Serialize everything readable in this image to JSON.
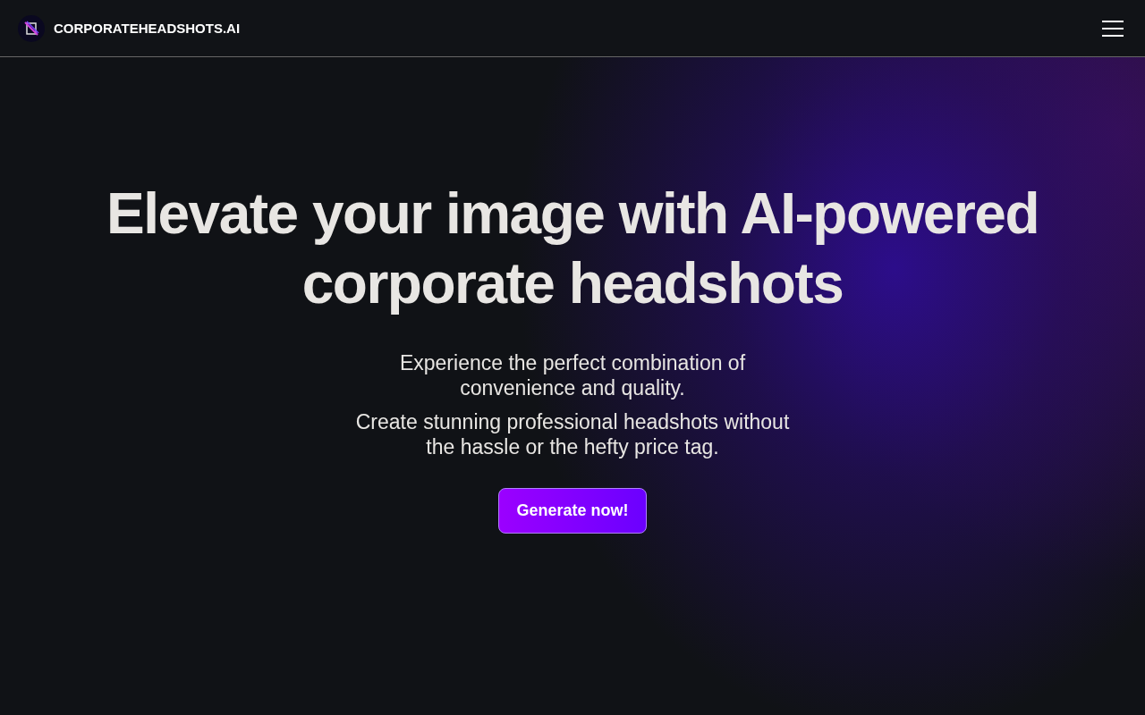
{
  "header": {
    "brand": "CORPORATEHEADSHOTS.AI"
  },
  "hero": {
    "title": "Elevate your image with AI-powered corporate headshots",
    "paragraphs": [
      "Experience the perfect combination of convenience and quality.",
      "Create stunning professional headshots without the hassle or the hefty price tag."
    ],
    "cta": "Generate now!"
  }
}
